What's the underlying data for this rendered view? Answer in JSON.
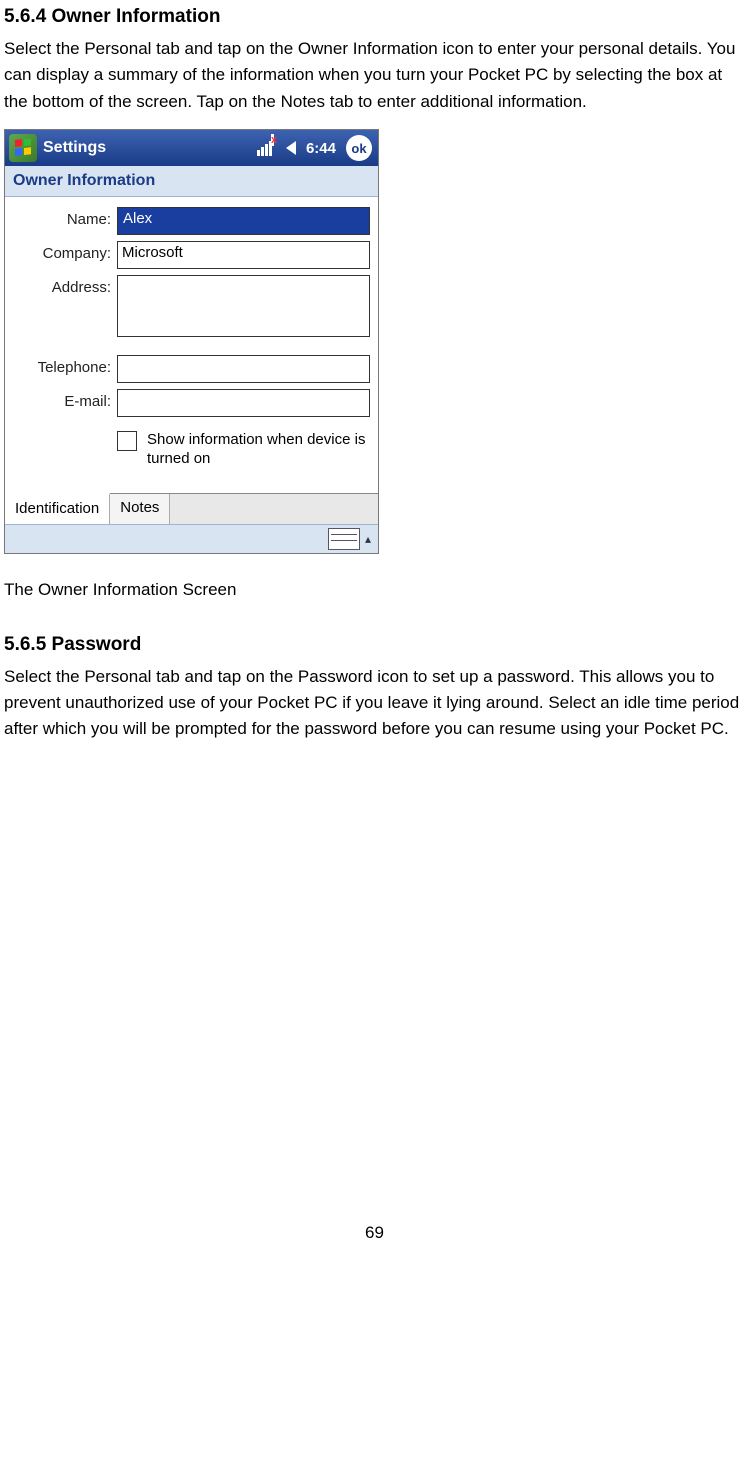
{
  "section1": {
    "heading": "5.6.4 Owner Information",
    "para": "Select the Personal tab and tap on the Owner Information icon to enter your personal details. You can display a summary of the information when you turn your Pocket PC by selecting the box at the bottom of the screen. Tap on the Notes tab to enter additional information."
  },
  "screenshot": {
    "titlebar": {
      "title": "Settings",
      "clock": "6:44",
      "ok": "ok"
    },
    "subheader": "Owner Information",
    "form": {
      "name_label": "Name:",
      "name_value": "Alex",
      "company_label": "Company:",
      "company_value": "Microsoft",
      "address_label": "Address:",
      "address_value": "",
      "telephone_label": "Telephone:",
      "telephone_value": "",
      "email_label": "E-mail:",
      "email_value": "",
      "checkbox_label": "Show information when device is turned on"
    },
    "tabs": {
      "active": "Identification",
      "other": "Notes"
    }
  },
  "caption": "The Owner Information Screen",
  "section2": {
    "heading": "5.6.5 Password",
    "para": "Select the Personal tab and tap on the Password icon to set up a password. This allows you to prevent unauthorized use of your Pocket PC if you leave it lying around. Select an idle time period after which you will be prompted for the password before you can resume using your Pocket PC."
  },
  "page_number": "69"
}
